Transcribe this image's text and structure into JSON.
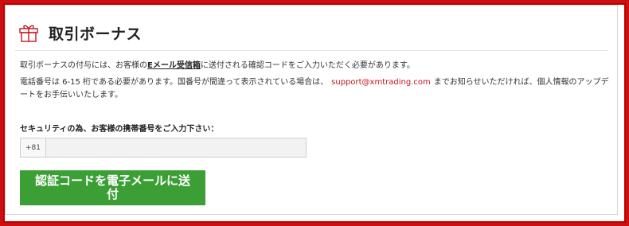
{
  "colors": {
    "page_border": "#cf0f0f",
    "accent_red": "#c5161d",
    "button_green": "#3b9f36"
  },
  "section": {
    "icon": "gift-icon",
    "title": "取引ボーナス"
  },
  "info": {
    "line1_before": "取引ボーナスの付与には、お客様の",
    "line1_link": "Eメール受信箱",
    "line1_after": "に送付される確認コードをご入力いただく必要があります。",
    "line2_before": "電話番号は 6-15 桁である必要があります。国番号が間違って表示されている場合は、",
    "line2_email": "support@xmtrading.com",
    "line2_after": "までお知らせいただければ、個人情報のアップデートをお手伝いいたします。"
  },
  "form": {
    "prompt": "セキュリティの為、お客様の携帯番号をご入力下さい：",
    "country_code": "+81",
    "phone_value": "",
    "submit_label": "認証コードを電子メールに送付"
  }
}
